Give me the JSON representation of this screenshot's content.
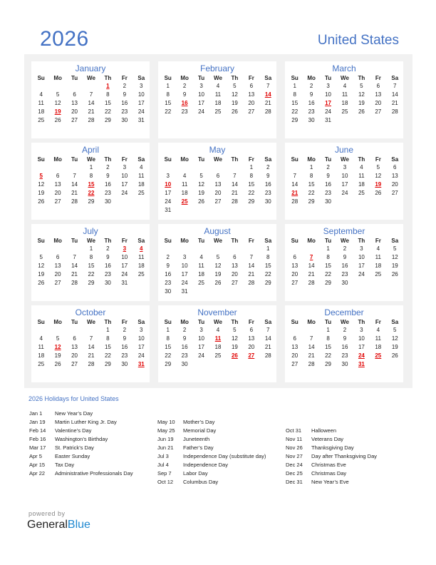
{
  "header": {
    "year": "2026",
    "country": "United States"
  },
  "weekdays": [
    "Su",
    "Mo",
    "Tu",
    "We",
    "Th",
    "Fr",
    "Sa"
  ],
  "months": [
    {
      "name": "January",
      "start": 4,
      "days": 31,
      "holidays": [
        1,
        19
      ]
    },
    {
      "name": "February",
      "start": 0,
      "days": 28,
      "holidays": [
        14,
        16
      ]
    },
    {
      "name": "March",
      "start": 0,
      "days": 31,
      "holidays": [
        17
      ]
    },
    {
      "name": "April",
      "start": 3,
      "days": 30,
      "holidays": [
        5,
        15,
        22
      ]
    },
    {
      "name": "May",
      "start": 5,
      "days": 31,
      "holidays": [
        10,
        25
      ]
    },
    {
      "name": "June",
      "start": 1,
      "days": 30,
      "holidays": [
        19,
        21
      ]
    },
    {
      "name": "July",
      "start": 3,
      "days": 31,
      "holidays": [
        3,
        4
      ]
    },
    {
      "name": "August",
      "start": 6,
      "days": 31,
      "holidays": []
    },
    {
      "name": "September",
      "start": 2,
      "days": 30,
      "holidays": [
        7
      ]
    },
    {
      "name": "October",
      "start": 4,
      "days": 31,
      "holidays": [
        12,
        31
      ]
    },
    {
      "name": "November",
      "start": 0,
      "days": 30,
      "holidays": [
        11,
        26,
        27
      ]
    },
    {
      "name": "December",
      "start": 2,
      "days": 31,
      "holidays": [
        24,
        25,
        31
      ]
    }
  ],
  "holidays_section": {
    "title": "2026 Holidays for United States",
    "columns": [
      [
        {
          "date": "Jan 1",
          "name": "New Year’s Day"
        },
        {
          "date": "Jan 19",
          "name": "Martin Luther King Jr. Day"
        },
        {
          "date": "Feb 14",
          "name": "Valentine’s Day"
        },
        {
          "date": "Feb 16",
          "name": "Washington’s Birthday"
        },
        {
          "date": "Mar 17",
          "name": "St. Patrick’s Day"
        },
        {
          "date": "Apr 5",
          "name": "Easter Sunday"
        },
        {
          "date": "Apr 15",
          "name": "Tax Day"
        },
        {
          "date": "Apr 22",
          "name": "Administrative Professionals Day"
        }
      ],
      [
        {
          "date": "May 10",
          "name": "Mother’s Day"
        },
        {
          "date": "May 25",
          "name": "Memorial Day"
        },
        {
          "date": "Jun 19",
          "name": "Juneteenth"
        },
        {
          "date": "Jun 21",
          "name": "Father’s Day"
        },
        {
          "date": "Jul 3",
          "name": "Independence Day (substitute day)"
        },
        {
          "date": "Jul 4",
          "name": "Independence Day"
        },
        {
          "date": "Sep 7",
          "name": "Labor Day"
        },
        {
          "date": "Oct 12",
          "name": "Columbus Day"
        }
      ],
      [
        {
          "date": "Oct 31",
          "name": "Halloween"
        },
        {
          "date": "Nov 11",
          "name": "Veterans Day"
        },
        {
          "date": "Nov 26",
          "name": "Thanksgiving Day"
        },
        {
          "date": "Nov 27",
          "name": "Day after Thanksgiving Day"
        },
        {
          "date": "Dec 24",
          "name": "Christmas Eve"
        },
        {
          "date": "Dec 25",
          "name": "Christmas Day"
        },
        {
          "date": "Dec 31",
          "name": "New Year’s Eve"
        }
      ]
    ]
  },
  "footer": {
    "powered_by": "powered by",
    "brand_part1": "General",
    "brand_part2": "Blue"
  },
  "colors": {
    "accent": "#4472C4",
    "holiday": "#e00000",
    "brand_blue": "#1e88d0",
    "panel_bg": "#f1f1f1"
  }
}
